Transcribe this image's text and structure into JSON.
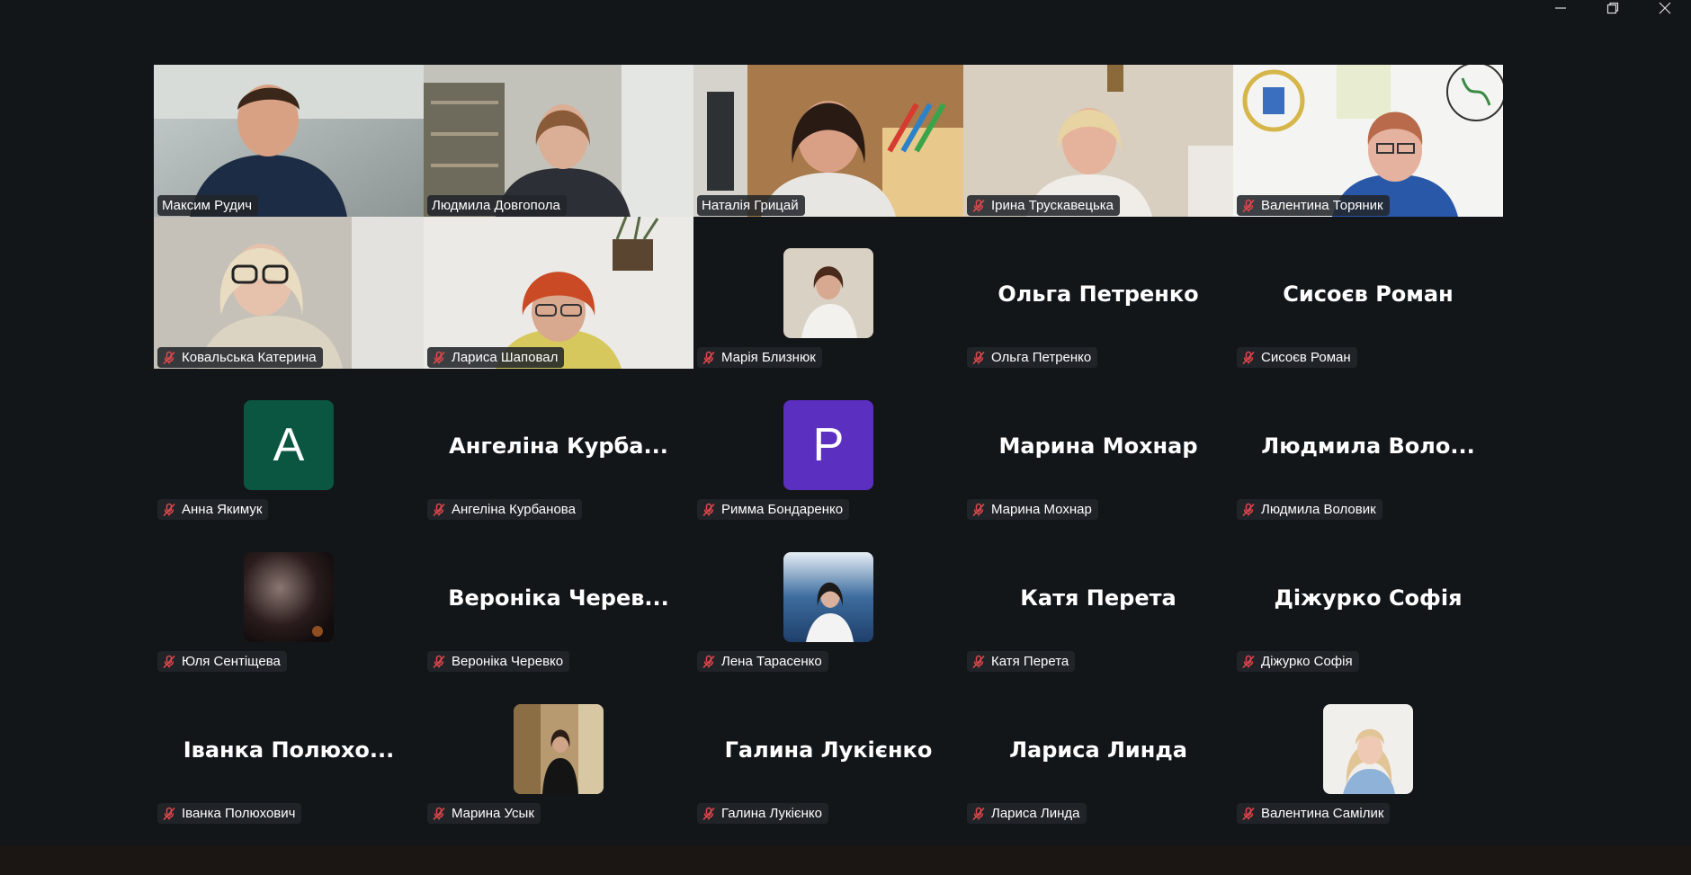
{
  "window": {
    "controls": [
      "minimize-icon",
      "restore-icon",
      "close-icon"
    ]
  },
  "colors": {
    "background": "#131619",
    "active_speaker_border": "#2fd17c",
    "muted_mic": "#e0484b",
    "avatar_a": "#0b5640",
    "avatar_p": "#5b2fbf"
  },
  "participants": [
    {
      "name": "Максим Рудич",
      "display": "video",
      "muted": false
    },
    {
      "name": "Людмила Довгопола",
      "display": "video",
      "muted": false
    },
    {
      "name": "Наталія Грицай",
      "display": "video",
      "muted": false,
      "active_speaker": true
    },
    {
      "name": "Ірина Трускавецька",
      "display": "video",
      "muted": true
    },
    {
      "name": "Валентина Торяник",
      "display": "video",
      "muted": true
    },
    {
      "name": "Ковальська Катерина",
      "display": "video",
      "muted": true
    },
    {
      "name": "Лариса Шаповал",
      "display": "video",
      "muted": true
    },
    {
      "name": "Марія Близнюк",
      "display": "photo",
      "muted": true
    },
    {
      "name": "Ольга Петренко",
      "display": "name",
      "big_name": "Ольга Петренко",
      "muted": true
    },
    {
      "name": "Сисоєв Роман",
      "display": "name",
      "big_name": "Сисоєв Роман",
      "muted": true
    },
    {
      "name": "Анна Якимук",
      "display": "initial",
      "initial": "A",
      "muted": true
    },
    {
      "name": "Ангеліна Курбанова",
      "display": "name",
      "big_name": "Ангеліна  Курба...",
      "muted": true
    },
    {
      "name": "Римма Бондаренко",
      "display": "initial",
      "initial": "P",
      "muted": true
    },
    {
      "name": "Марина Мохнар",
      "display": "name",
      "big_name": "Марина Мохнар",
      "muted": true
    },
    {
      "name": "Людмила Воловик",
      "display": "name",
      "big_name": "Людмила  Воло...",
      "muted": true
    },
    {
      "name": "Юля Сентіщева",
      "display": "photo",
      "muted": true
    },
    {
      "name": "Вероніка Черевко",
      "display": "name",
      "big_name": "Вероніка  Черев...",
      "muted": true
    },
    {
      "name": "Лена Тарасенко",
      "display": "photo",
      "muted": true
    },
    {
      "name": "Катя Перета",
      "display": "name",
      "big_name": "Катя Перета",
      "muted": true
    },
    {
      "name": "Діжурко Софія",
      "display": "name",
      "big_name": "Діжурко Софія",
      "muted": true
    },
    {
      "name": "Іванка Полюхович",
      "display": "name",
      "big_name": "Іванка  Полюхо...",
      "muted": true
    },
    {
      "name": "Марина Усык",
      "display": "photo",
      "muted": true
    },
    {
      "name": "Галина Лукієнко",
      "display": "name",
      "big_name": "Галина Лукієнко",
      "muted": true
    },
    {
      "name": "Лариса Линда",
      "display": "name",
      "big_name": "Лариса Линда",
      "muted": true
    },
    {
      "name": "Валентина Самілик",
      "display": "photo",
      "muted": true
    }
  ]
}
